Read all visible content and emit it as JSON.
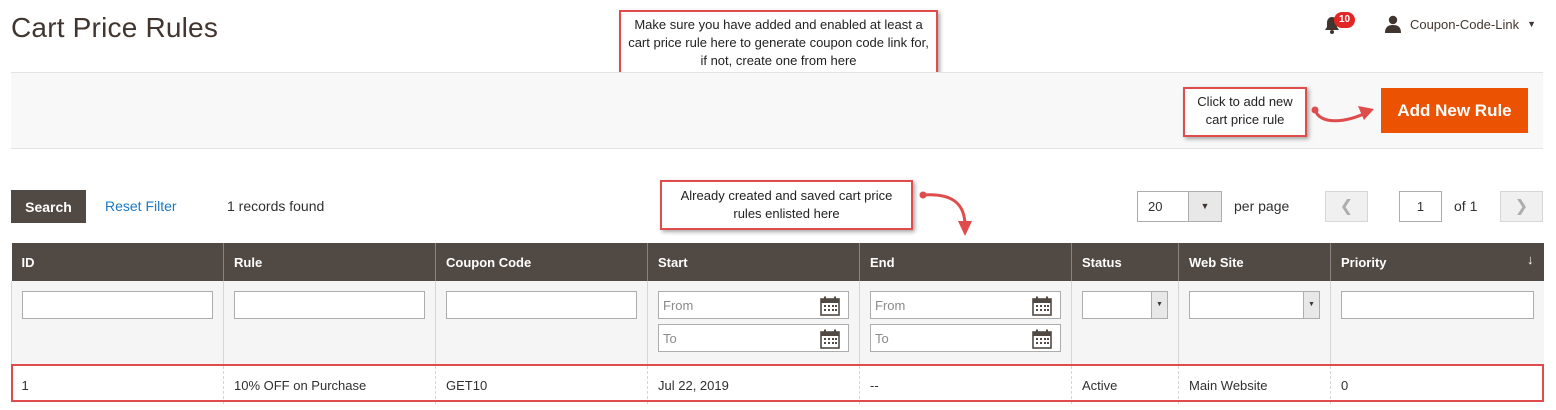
{
  "page": {
    "title": "Cart Price Rules"
  },
  "header": {
    "notifications_count": "10",
    "user_name": "Coupon-Code-Link"
  },
  "actions": {
    "add_new_rule_label": "Add New Rule"
  },
  "callouts": {
    "top": "Make sure you have added and enabled at least a cart price rule here to generate coupon code link for, if not, create one from here",
    "add_rule": "Click to add new cart price rule",
    "list": "Already created and saved cart price rules enlisted here"
  },
  "toolbar": {
    "search_label": "Search",
    "reset_filter_label": "Reset Filter",
    "records_found": "1 records found",
    "per_page_value": "20",
    "per_page_label": "per page",
    "current_page": "1",
    "of_pages": "of 1"
  },
  "grid": {
    "columns": [
      "ID",
      "Rule",
      "Coupon Code",
      "Start",
      "End",
      "Status",
      "Web Site",
      "Priority"
    ],
    "filters": {
      "from_placeholder": "From",
      "to_placeholder": "To"
    },
    "rows": [
      [
        "1",
        "10% OFF on Purchase",
        "GET10",
        "Jul 22, 2019",
        "--",
        "Active",
        "Main Website",
        "0"
      ]
    ]
  },
  "colors": {
    "accent": "#eb5202",
    "header_bg": "#514943",
    "callout_border": "#e04b4b",
    "link": "#1979c3"
  },
  "icons": [
    "bell-icon",
    "user-icon",
    "chevron-down-icon",
    "calendar-icon",
    "sort-arrow-icon",
    "arrow-left-icon",
    "arrow-right-icon"
  ]
}
